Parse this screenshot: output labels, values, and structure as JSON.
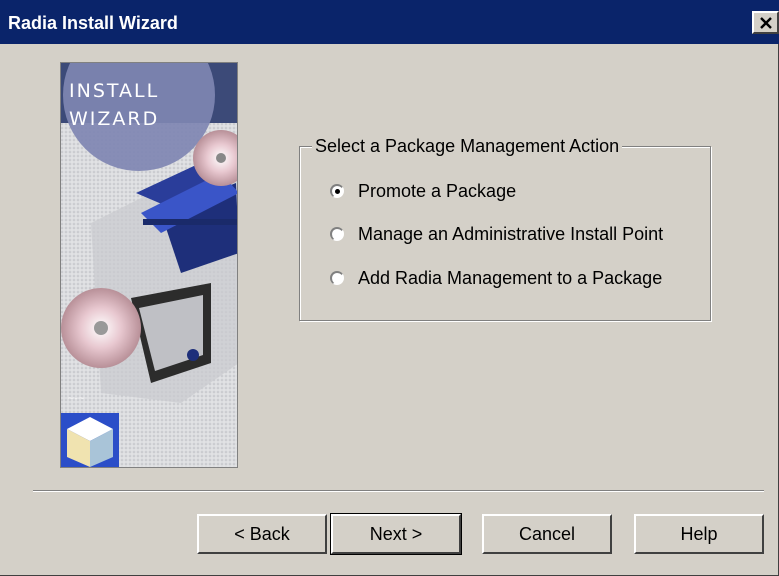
{
  "window": {
    "title": "Radia Install Wizard",
    "close_icon": "close-icon"
  },
  "side_image": {
    "heading_line1": "INSTALL",
    "heading_line2": "WIZARD",
    "icon": "install-wizard-graphic"
  },
  "group": {
    "legend": "Select a Package Management Action",
    "options": [
      {
        "label": "Promote a Package",
        "selected": true
      },
      {
        "label": "Manage an Administrative Install Point",
        "selected": false
      },
      {
        "label": "Add Radia Management to a Package",
        "selected": false
      }
    ]
  },
  "buttons": {
    "back": "< Back",
    "next": "Next >",
    "cancel": "Cancel",
    "help": "Help"
  },
  "colors": {
    "titlebar": "#0a246a",
    "face": "#d4d0c8"
  }
}
